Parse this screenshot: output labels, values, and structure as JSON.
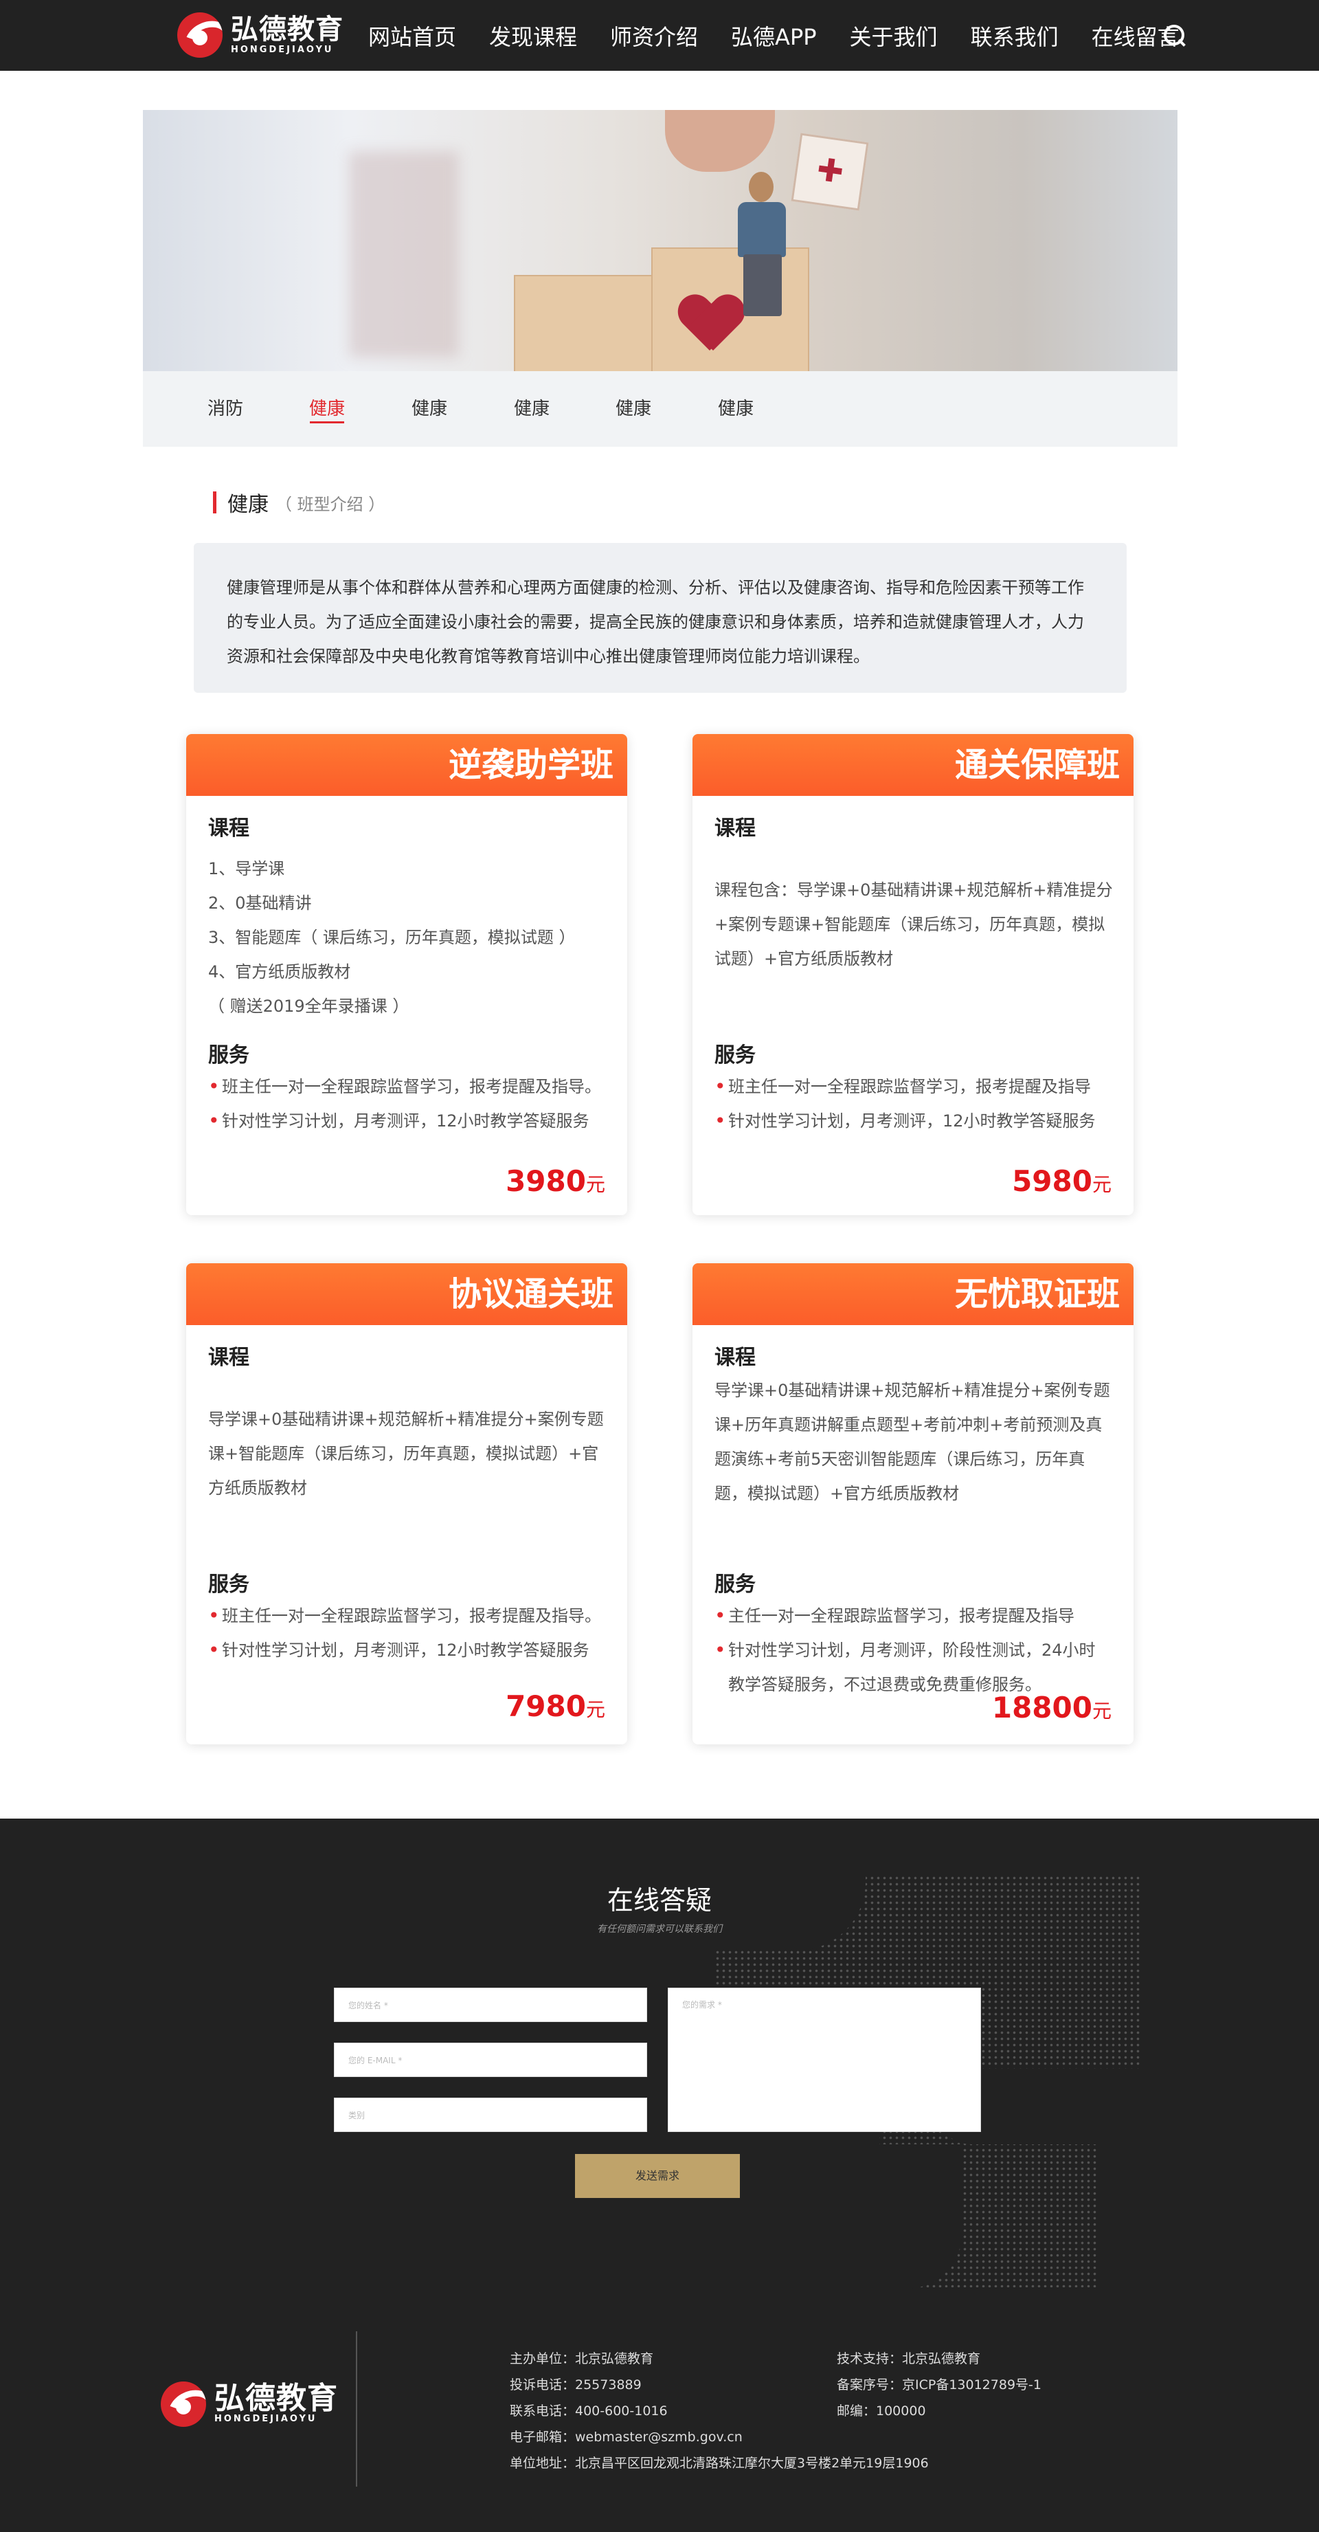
{
  "header": {
    "logo_cn": "弘德教育",
    "logo_en": "HONGDEJIAOYU",
    "nav": [
      "网站首页",
      "发现课程",
      "师资介绍",
      "弘德APP",
      "关于我们",
      "联系我们",
      "在线留言"
    ]
  },
  "tabs": [
    "消防",
    "健康",
    "健康",
    "健康",
    "健康",
    "健康"
  ],
  "active_tab": 1,
  "section": {
    "title": "健康",
    "subtitle": "（ 班型介绍 ）"
  },
  "intro": "健康管理师是从事个体和群体从营养和心理两方面健康的检测、分析、评估以及健康咨询、指导和危险因素干预等工作的专业人员。为了适应全面建设小康社会的需要，提高全民族的健康意识和身体素质，培养和造就健康管理人才，人力资源和社会保障部及中央电化教育馆等教育培训中心推出健康管理师岗位能力培训课程。",
  "cards": [
    {
      "title": "逆袭助学班",
      "course_heading": "课程",
      "course_lines": [
        "1、导学课",
        "2、0基础精讲",
        "3、智能题库（ 课后练习，历年真题，模拟试题 ）",
        "4、官方纸质版教材",
        "（ 赠送2019全年录播课 ）"
      ],
      "service_heading": "服务",
      "services": [
        "班主任一对一全程跟踪监督学习，报考提醒及指导。",
        "针对性学习计划，月考测评，12小时教学答疑服务"
      ],
      "price": "3980",
      "unit": "元"
    },
    {
      "title": "通关保障班",
      "course_heading": "课程",
      "course_text": "课程包含：导学课+0基础精讲课+规范解析+精准提分+案例专题课+智能题库（课后练习，历年真题，模拟试题）+官方纸质版教材",
      "service_heading": "服务",
      "services": [
        "班主任一对一全程跟踪监督学习，报考提醒及指导",
        "针对性学习计划，月考测评，12小时教学答疑服务"
      ],
      "price": "5980",
      "unit": "元"
    },
    {
      "title": "协议通关班",
      "course_heading": "课程",
      "course_text": "导学课+0基础精讲课+规范解析+精准提分+案例专题课+智能题库（课后练习，历年真题，模拟试题）+官方纸质版教材",
      "service_heading": "服务",
      "services": [
        "班主任一对一全程跟踪监督学习，报考提醒及指导。",
        "针对性学习计划，月考测评，12小时教学答疑服务"
      ],
      "price": "7980",
      "unit": "元"
    },
    {
      "title": "无忧取证班",
      "course_heading": "课程",
      "course_text": "导学课+0基础精讲课+规范解析+精准提分+案例专题课+历年真题讲解重点题型+考前冲刺+考前预测及真题演练+考前5天密训智能题库（课后练习，历年真题，模拟试题）+官方纸质版教材",
      "service_heading": "服务",
      "services": [
        "主任一对一全程跟踪监督学习，报考提醒及指导",
        "针对性学习计划，月考测评，阶段性测试，24小时教学答疑服务，不过退费或免费重修服务。"
      ],
      "price": "18800",
      "unit": "元"
    }
  ],
  "form": {
    "title": "在线答疑",
    "subtitle": "有任何额问需求可以联系我们",
    "name_placeholder": "您的姓名 *",
    "email_placeholder": "您的 E-MAIL *",
    "note_placeholder": "类别",
    "message_placeholder": "您的需求 *",
    "submit": "发送需求"
  },
  "footer": {
    "host": "主办单位：北京弘德教育",
    "complaint": "投诉电话：25573889",
    "phone": "联系电话：400-600-1016",
    "email": "电子邮箱：webmaster@szmb.gov.cn",
    "address": "单位地址：北京昌平区回龙观北清路珠江摩尔大厦3号楼2单元19层1906",
    "tech": "技术支持：北京弘德教育",
    "icp": "备案序号：京ICP备13012789号-1",
    "zip": "邮编：100000"
  }
}
